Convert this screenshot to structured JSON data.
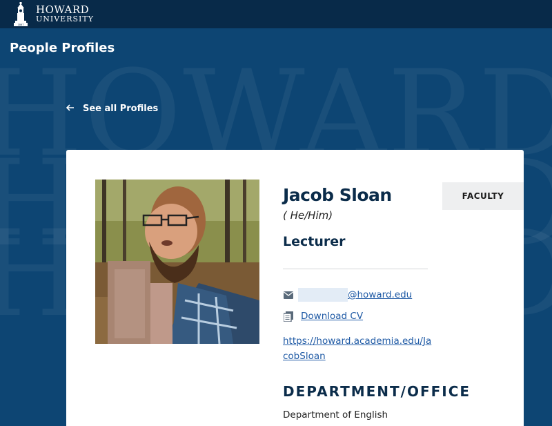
{
  "header": {
    "logo_line1": "HOWARD",
    "logo_line2": "UNIVERSITY",
    "logo_year": "1867"
  },
  "hero": {
    "background_word": "HOWARD",
    "page_heading": "People Profiles",
    "back_link_label": "See all Profiles"
  },
  "profile": {
    "name": "Jacob Sloan",
    "pronouns": "( He/Him)",
    "title": "Lecturer",
    "badge": "FACULTY",
    "email_domain": "@howard.edu",
    "cv_label": "Download CV",
    "url": "https://howard.academia.edu/JacobSloan",
    "department_heading": "DEPARTMENT/OFFICE",
    "department": "Department of English"
  },
  "icons": {
    "logo": "tower-icon",
    "back": "arrow-left-icon",
    "email": "envelope-icon",
    "cv": "document-icon"
  },
  "colors": {
    "topbar": "#082a49",
    "hero": "#0d4573",
    "heading": "#0b2c4a",
    "link": "#1f5aa5",
    "badge_bg": "#eeeff0"
  }
}
